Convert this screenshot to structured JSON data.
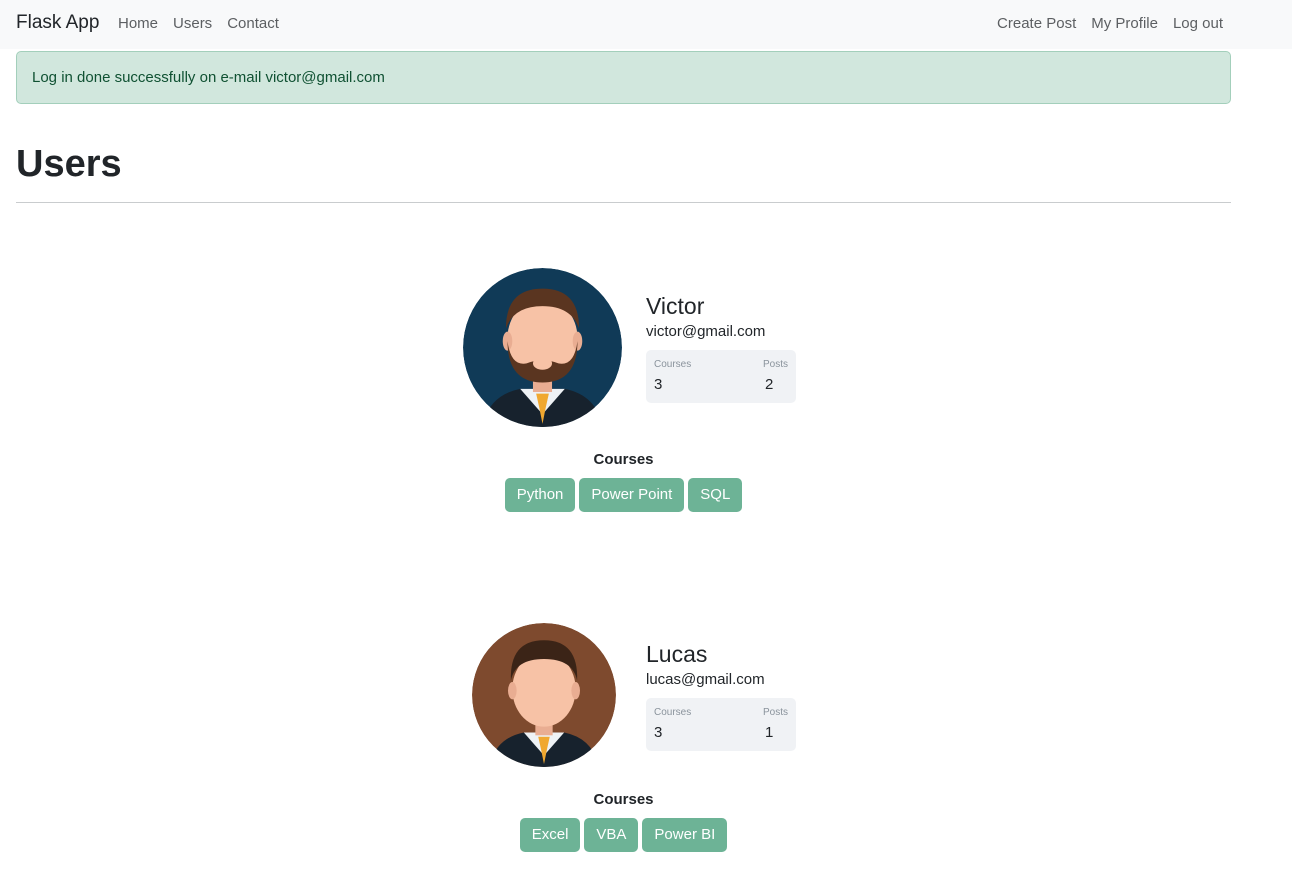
{
  "navbar": {
    "brand": "Flask App",
    "left_links": [
      "Home",
      "Users",
      "Contact"
    ],
    "right_links": [
      "Create Post",
      "My Profile",
      "Log out"
    ]
  },
  "alert": {
    "message": "Log in done successfully on e-mail victor@gmail.com"
  },
  "page": {
    "title": "Users"
  },
  "colors": {
    "navbar_bg": "#f8f9fa",
    "alert_bg": "#d1e7dd",
    "alert_text": "#0f5132",
    "badge_bg": "#6db396",
    "stats_bg": "#f0f2f5"
  },
  "users": [
    {
      "name": "Victor",
      "email": "victor@gmail.com",
      "avatar": "bearded-man-avatar",
      "stats": {
        "courses_label": "Courses",
        "courses": "3",
        "posts_label": "Posts",
        "posts": "2"
      },
      "courses_title": "Courses",
      "courses": [
        "Python",
        "Power Point",
        "SQL"
      ]
    },
    {
      "name": "Lucas",
      "email": "lucas@gmail.com",
      "avatar": "man-avatar",
      "stats": {
        "courses_label": "Courses",
        "courses": "3",
        "posts_label": "Posts",
        "posts": "1"
      },
      "courses_title": "Courses",
      "courses": [
        "Excel",
        "VBA",
        "Power BI"
      ]
    }
  ]
}
